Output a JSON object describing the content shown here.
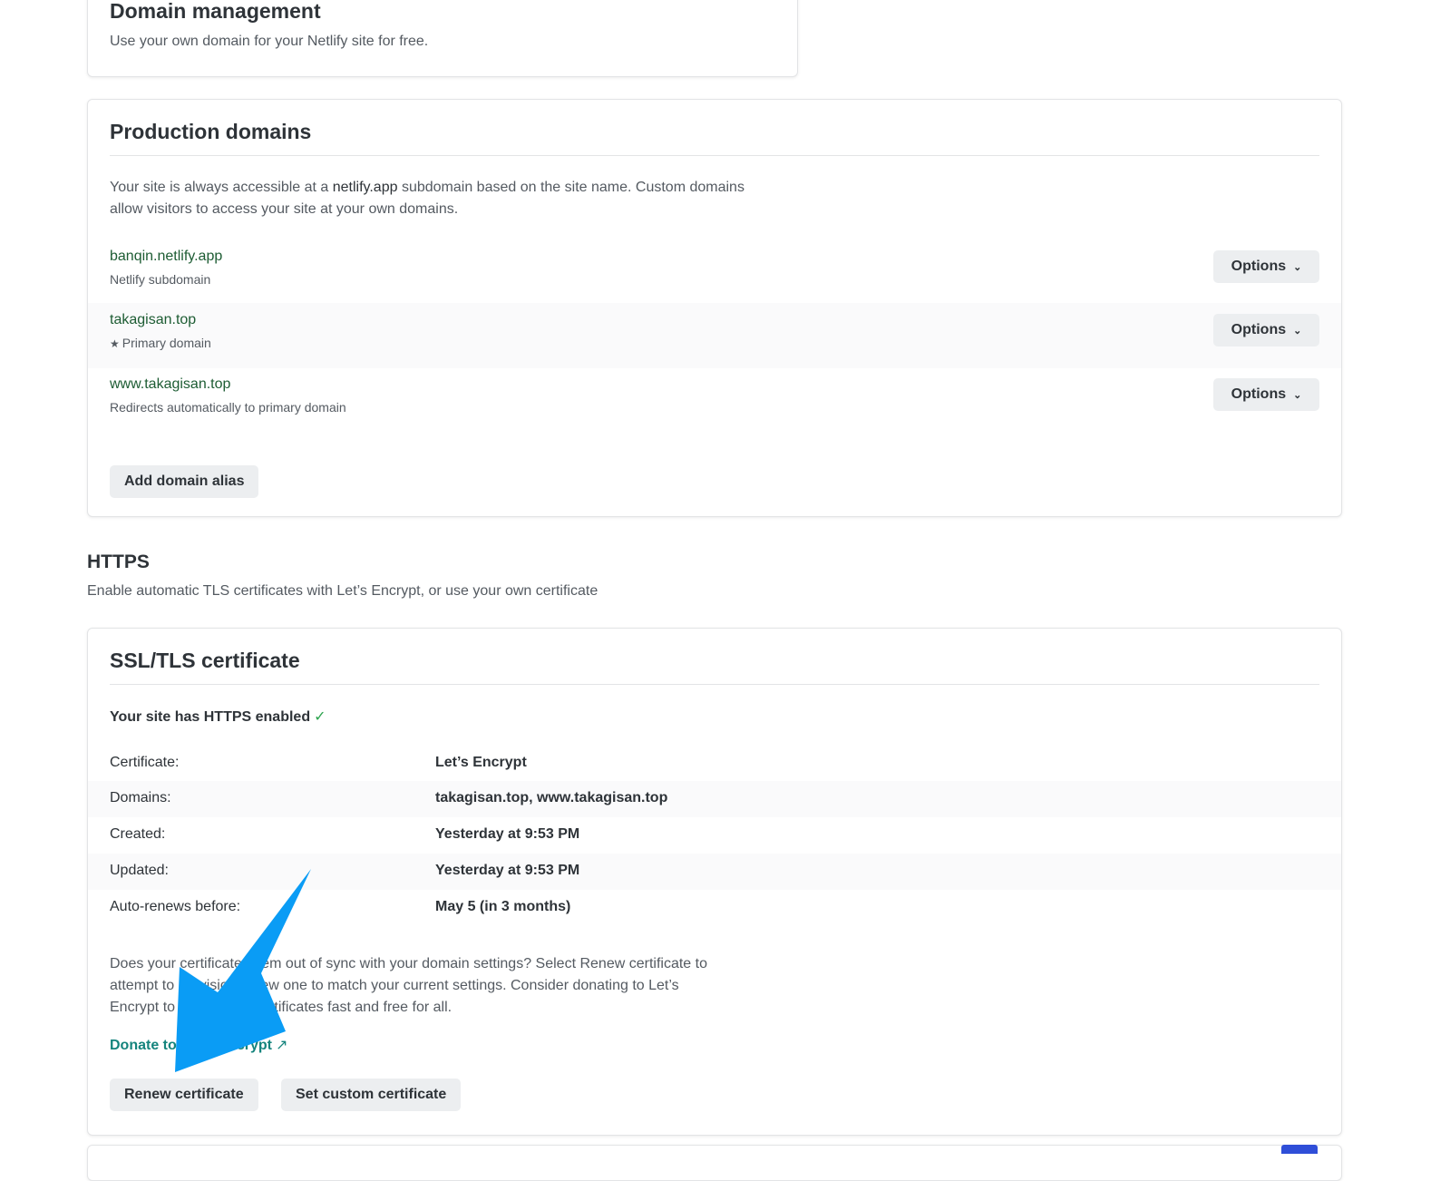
{
  "domain_management": {
    "title": "Domain management",
    "description": "Use your own domain for your Netlify site for free."
  },
  "production_domains": {
    "title": "Production domains",
    "description_part1": "Your site is always accessible at a ",
    "description_highlight": "netlify.app",
    "description_part2": " subdomain based on the site name. Custom domains allow visitors to access your site at your own domains.",
    "domains": [
      {
        "name": "banqin.netlify.app",
        "subtitle": "Netlify subdomain",
        "options_label": "Options",
        "star": false
      },
      {
        "name": "takagisan.top",
        "subtitle": "Primary domain",
        "options_label": "Options",
        "star": true
      },
      {
        "name": "www.takagisan.top",
        "subtitle": "Redirects automatically to primary domain",
        "options_label": "Options",
        "star": false
      }
    ],
    "add_alias_label": "Add domain alias"
  },
  "https": {
    "title": "HTTPS",
    "description": "Enable automatic TLS certificates with Let’s Encrypt, or use your own certificate"
  },
  "ssl": {
    "title": "SSL/TLS certificate",
    "status": "Your site has HTTPS enabled",
    "status_check": "✓",
    "rows": [
      {
        "key": "Certificate:",
        "value": "Let’s Encrypt"
      },
      {
        "key": "Domains:",
        "value": "takagisan.top, www.takagisan.top"
      },
      {
        "key": "Created:",
        "value": "Yesterday at 9:53 PM"
      },
      {
        "key": "Updated:",
        "value": "Yesterday at 9:53 PM"
      },
      {
        "key": "Auto-renews before:",
        "value": "May 5 (in 3 months)"
      }
    ],
    "note": "Does your certificate seem out of sync with your domain settings? Select Renew certificate to attempt to provision a new one to match your current settings. Consider donating to Let’s Encrypt to keep these certificates fast and free for all.",
    "donate_label": "Donate to Let’s Encrypt",
    "donate_icon": "↗",
    "renew_label": "Renew certificate",
    "custom_label": "Set custom certificate"
  },
  "colors": {
    "domain_link": "#1d5c33",
    "donate_link": "#15847d",
    "check": "#2ea44f",
    "annotation_arrow": "#0a9cf5"
  },
  "icons": {
    "star": "★",
    "chevron": "⌄",
    "check": "✓",
    "external": "↗"
  }
}
